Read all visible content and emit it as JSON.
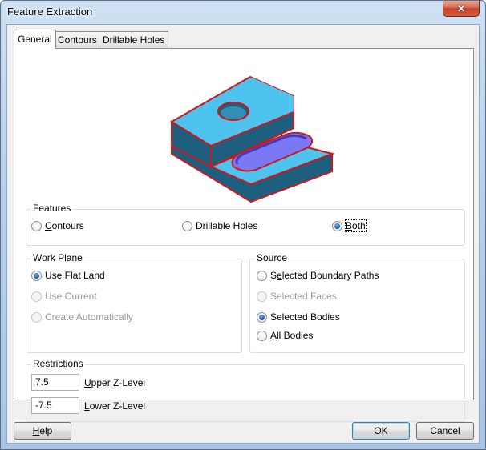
{
  "window": {
    "title": "Feature Extraction",
    "close_symbol": "✕"
  },
  "tabs": [
    {
      "label": "General",
      "active": true
    },
    {
      "label": "Contours",
      "active": false
    },
    {
      "label": "Drillable Holes",
      "active": false
    }
  ],
  "illustration": {
    "icon": "3d-part-preview-icon",
    "colors": {
      "face": "#4ec3ee",
      "side": "#1d5f7e",
      "edge": "#d0161d",
      "pocket": "#7a78f2"
    }
  },
  "features": {
    "label": "Features",
    "options": [
      {
        "label": "Contours",
        "ul": "C",
        "rest": "ontours",
        "selected": false
      },
      {
        "label": "Drillable Holes",
        "selected": false
      },
      {
        "label": "Both",
        "ul": "B",
        "rest": "oth",
        "selected": true
      }
    ]
  },
  "work_plane": {
    "label": "Work Plane",
    "options": [
      {
        "label": "Use Flat Land",
        "selected": true,
        "enabled": true
      },
      {
        "label": "Use Current",
        "selected": false,
        "enabled": false
      },
      {
        "label": "Create Automatically",
        "selected": false,
        "enabled": false
      }
    ]
  },
  "source": {
    "label": "Source",
    "options": [
      {
        "label": "Selected Boundary Paths",
        "ul_pre": "S",
        "ul": "e",
        "rest": "lected Boundary Paths",
        "selected": false,
        "enabled": true
      },
      {
        "label": "Selected Faces",
        "selected": false,
        "enabled": false
      },
      {
        "label": "Selected Bodies",
        "selected": true,
        "enabled": true
      },
      {
        "label": "All Bodies",
        "ul": "A",
        "rest": "ll Bodies",
        "selected": false,
        "enabled": true
      }
    ]
  },
  "restrictions": {
    "label": "Restrictions",
    "upper": {
      "value": "7.5",
      "ul": "U",
      "rest": "pper Z-Level"
    },
    "lower": {
      "value": "-7.5",
      "ul": "L",
      "rest": "ower Z-Level"
    }
  },
  "buttons": {
    "help": {
      "ul": "H",
      "rest": "elp"
    },
    "ok": "OK",
    "cancel": "Cancel"
  }
}
